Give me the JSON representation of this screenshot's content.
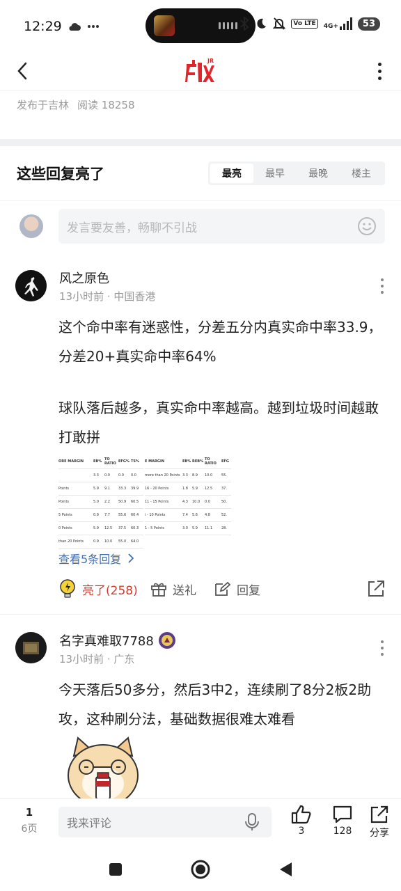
{
  "status": {
    "time": "12:29",
    "network": "4G+",
    "volte": "Vo LTE",
    "battery": "53"
  },
  "post_meta": {
    "location": "发布于吉林",
    "reads": "阅读 18258"
  },
  "replies_section": {
    "title": "这些回复亮了",
    "sort_tabs": [
      "最亮",
      "最早",
      "最晚",
      "楼主"
    ],
    "active_tab": "最亮"
  },
  "compose": {
    "placeholder": "发言要友善，畅聊不引战"
  },
  "comments": [
    {
      "user": "风之原色",
      "meta": "13小时前 · 中国香港",
      "text_1": "这个命中率有迷惑性，分差五分内真实命中率33.9，分差20+真实命中率64%",
      "text_2": "球队落后越多，真实命中率越高。越到垃圾时间越敢打敢拼",
      "table_left": {
        "headers": [
          "ORE MARGIN",
          "EB%",
          "TO RATIO",
          "EFG%",
          "TS%"
        ],
        "rows": [
          [
            "",
            "3.3",
            "0.0",
            "0.0",
            "0.0"
          ],
          [
            "Points",
            "5.9",
            "9.1",
            "33.3",
            "39.9"
          ],
          [
            "Points",
            "5.0",
            "2.2",
            "50.9",
            "60.5"
          ],
          [
            "5 Points",
            "0.9",
            "7.7",
            "55.6",
            "60.4"
          ],
          [
            "0 Points",
            "5.9",
            "12.5",
            "37.5",
            "60.3"
          ],
          [
            "than 20 Points",
            "0.9",
            "10.0",
            "55.0",
            "64.0"
          ]
        ]
      },
      "table_right": {
        "headers": [
          "E MARGIN",
          "EB%",
          "REB%",
          "TO RATIO",
          "EFG"
        ],
        "rows": [
          [
            "more than 20 Points",
            "3.3",
            "8.9",
            "10.0",
            "55."
          ],
          [
            "16 - 20 Points",
            "1.8",
            "5.9",
            "12.5",
            "37."
          ],
          [
            "11 - 15 Points",
            "4.3",
            "10.0",
            "0.0",
            "50."
          ],
          [
            "i - 10 Points",
            "7.4",
            "5.6",
            "4.8",
            "52."
          ],
          [
            "1 - 5 Points",
            "3.0",
            "5.9",
            "11.1",
            "28."
          ]
        ]
      },
      "view_replies": "查看5条回复",
      "actions": {
        "light": "亮了(258)",
        "gift": "送礼",
        "reply": "回复"
      }
    },
    {
      "user": "名字真难取7788",
      "meta": "13小时前 · 广东",
      "text_1": "今天落后50多分，然后3中2，连续刷了8分2板2助攻，这种刷分法，基础数据很难太难看"
    }
  ],
  "bottom_bar": {
    "page_current": "1",
    "page_total": "6页",
    "comment_placeholder": "我来评论",
    "likes": "3",
    "comments": "128",
    "share": "分享"
  },
  "colors": {
    "accent_red": "#d23c2e",
    "link_blue": "#3f6fb5",
    "logo_red": "#e0262b"
  }
}
